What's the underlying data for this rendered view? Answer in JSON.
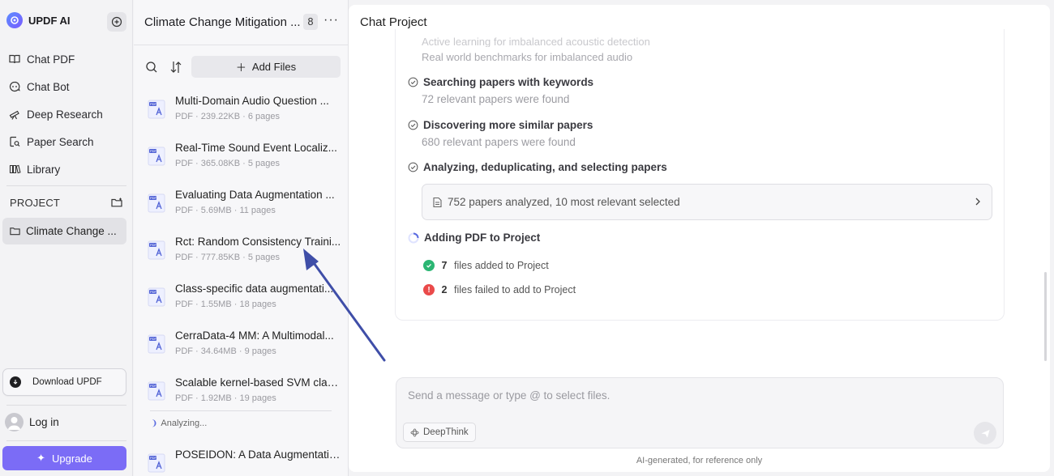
{
  "colors": {
    "accent": "#7b6cf6",
    "annotation_arrow": "#3f4ea8",
    "success": "#2bb673",
    "error": "#ea4a4a"
  },
  "nav": {
    "brand": "UPDF AI",
    "items": [
      {
        "label": "Chat PDF",
        "icon": "book-open-icon"
      },
      {
        "label": "Chat Bot",
        "icon": "chat-bot-icon"
      },
      {
        "label": "Deep Research",
        "icon": "telescope-icon"
      },
      {
        "label": "Paper Search",
        "icon": "document-search-icon"
      },
      {
        "label": "Library",
        "icon": "library-icon"
      }
    ],
    "project_header": "PROJECT",
    "project_item": "Climate Change ...",
    "download_label": "Download UPDF",
    "login_label": "Log in",
    "upgrade_label": "Upgrade"
  },
  "files_panel": {
    "title": "Climate Change Mitigation ...",
    "count": "8",
    "more": "···",
    "add_files": "Add Files",
    "files": [
      {
        "name": "Multi-Domain Audio Question ...",
        "meta": "PDF · 239.22KB · 6 pages"
      },
      {
        "name": "Real-Time Sound Event Localiz...",
        "meta": "PDF · 365.08KB · 5 pages"
      },
      {
        "name": "Evaluating Data Augmentation ...",
        "meta": "PDF · 5.69MB · 11 pages"
      },
      {
        "name": "Rct: Random Consistency Traini...",
        "meta": "PDF · 777.85KB · 5 pages"
      },
      {
        "name": "Class-specific data augmentati...",
        "meta": "PDF · 1.55MB · 18 pages"
      },
      {
        "name": "CerraData-4 MM: A Multimodal...",
        "meta": "PDF · 34.64MB · 9 pages"
      },
      {
        "name": "Scalable kernel-based SVM class...",
        "meta": "PDF · 1.92MB · 19 pages"
      }
    ],
    "analyzing": "Analyzing...",
    "pending_file": {
      "name": "POSEIDON: A Data Augmentatio..."
    }
  },
  "chat": {
    "title": "Chat Project",
    "faded_line_top": "Active learning for imbalanced acoustic detection",
    "faded_line": "Real world benchmarks for imbalanced audio",
    "steps": [
      {
        "title": "Searching papers with keywords",
        "sub": "72 relevant papers were found"
      },
      {
        "title": "Discovering more similar papers",
        "sub": "680 relevant papers were found"
      },
      {
        "title": "Analyzing, deduplicating, and selecting papers",
        "sub": ""
      },
      {
        "title": "Adding PDF to Project",
        "sub": ""
      }
    ],
    "summary": "752 papers analyzed, 10 most relevant selected",
    "results": {
      "added_count": "7",
      "added_label": "files added to Project",
      "failed_count": "2",
      "failed_label": "files failed to add to Project"
    },
    "composer_placeholder": "Send a message or type @ to select files.",
    "deepthink_label": "DeepThink",
    "disclaimer": "AI-generated, for reference only"
  }
}
